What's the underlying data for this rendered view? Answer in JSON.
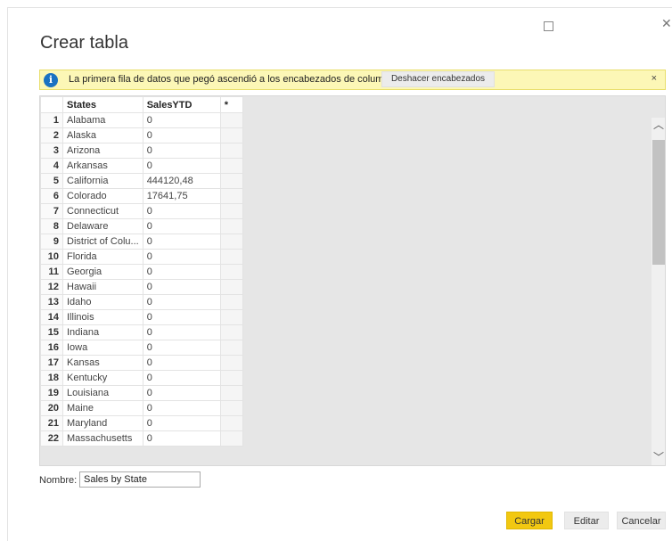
{
  "dialog": {
    "title": "Crear tabla",
    "restore_icon": "restore-icon",
    "close_glyph": "✕"
  },
  "infobar": {
    "icon_glyph": "i",
    "message": "La primera fila de datos que pegó ascendió a los encabezados de columna.",
    "undo_label": "Deshacer encabezados",
    "close_glyph": "×"
  },
  "table": {
    "columns": [
      "States",
      "SalesYTD",
      "*"
    ],
    "rows": [
      {
        "n": "1",
        "state": "Alabama",
        "sales": "0"
      },
      {
        "n": "2",
        "state": "Alaska",
        "sales": "0"
      },
      {
        "n": "3",
        "state": "Arizona",
        "sales": "0"
      },
      {
        "n": "4",
        "state": "Arkansas",
        "sales": "0"
      },
      {
        "n": "5",
        "state": "California",
        "sales": "444120,48"
      },
      {
        "n": "6",
        "state": "Colorado",
        "sales": "17641,75"
      },
      {
        "n": "7",
        "state": "Connecticut",
        "sales": "0"
      },
      {
        "n": "8",
        "state": "Delaware",
        "sales": "0"
      },
      {
        "n": "9",
        "state": "District of Colu...",
        "sales": "0"
      },
      {
        "n": "10",
        "state": "Florida",
        "sales": "0"
      },
      {
        "n": "11",
        "state": "Georgia",
        "sales": "0"
      },
      {
        "n": "12",
        "state": "Hawaii",
        "sales": "0"
      },
      {
        "n": "13",
        "state": "Idaho",
        "sales": "0"
      },
      {
        "n": "14",
        "state": "Illinois",
        "sales": "0"
      },
      {
        "n": "15",
        "state": "Indiana",
        "sales": "0"
      },
      {
        "n": "16",
        "state": "Iowa",
        "sales": "0"
      },
      {
        "n": "17",
        "state": "Kansas",
        "sales": "0"
      },
      {
        "n": "18",
        "state": "Kentucky",
        "sales": "0"
      },
      {
        "n": "19",
        "state": "Louisiana",
        "sales": "0"
      },
      {
        "n": "20",
        "state": "Maine",
        "sales": "0"
      },
      {
        "n": "21",
        "state": "Maryland",
        "sales": "0"
      },
      {
        "n": "22",
        "state": "Massachusetts",
        "sales": "0"
      }
    ]
  },
  "name_field": {
    "label": "Nombre:",
    "value": "Sales by State"
  },
  "buttons": {
    "load": "Cargar",
    "edit": "Editar",
    "cancel": "Cancelar"
  },
  "colors": {
    "accent": "#f2c811",
    "info_bg": "#fcf7b6",
    "info_icon": "#1a72c2"
  }
}
